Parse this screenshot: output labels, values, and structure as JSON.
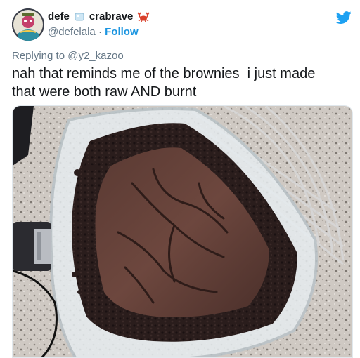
{
  "author": {
    "display_name_first": "defe",
    "display_name_second": "crabrave",
    "handle": "@defelala",
    "separator": "·",
    "follow_label": "Follow"
  },
  "reply": {
    "prefix": "Replying to",
    "target": "@y2_kazoo"
  },
  "tweet": {
    "line1": "nah that reminds me of the brownies  i just made",
    "line2": "that were both raw AND burnt"
  },
  "icons": {
    "ice": "ice-cube-icon",
    "crab": "crab-icon",
    "brand": "twitter-bird-icon"
  },
  "colors": {
    "link": "#1b95e0",
    "brand": "#1da1f2",
    "text": "#14171a",
    "muted": "#657786"
  }
}
